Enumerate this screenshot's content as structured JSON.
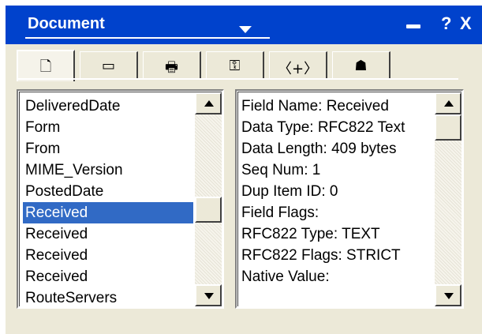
{
  "titlebar": {
    "title": "Document",
    "icons": [
      "dropdown-arrow-icon",
      "dock-icon",
      "help-icon",
      "close-icon"
    ],
    "help_label": "?",
    "close_label": "X"
  },
  "tabs": [
    {
      "icon": "page-info-icon",
      "glyph": "🗋",
      "active": true
    },
    {
      "icon": "ruler-icon",
      "glyph": "▭",
      "active": false
    },
    {
      "icon": "printer-icon",
      "glyph": "🖶",
      "active": false
    },
    {
      "icon": "key-icon",
      "glyph": "⚿",
      "active": false
    },
    {
      "icon": "html-tag-icon",
      "glyph": "〈+〉",
      "active": false
    },
    {
      "icon": "network-icon",
      "glyph": "☗",
      "active": false
    }
  ],
  "fields_list": {
    "items": [
      "DeliveredDate",
      "Form",
      "From",
      "MIME_Version",
      "PostedDate",
      "Received",
      "Received",
      "Received",
      "Received",
      "RouteServers"
    ],
    "selected_index": 5
  },
  "field_details": {
    "lines": [
      "Field Name: Received",
      "Data Type: RFC822 Text",
      "Data Length: 409 bytes",
      "Seq Num: 1",
      "Dup Item ID: 0",
      "Field Flags:",
      "RFC822 Type: TEXT",
      "RFC822 Flags: STRICT",
      "Native Value:"
    ]
  },
  "colors": {
    "titlebar": "#0042cc",
    "selection": "#316ac5",
    "dialog_bg": "#ece9d8"
  }
}
